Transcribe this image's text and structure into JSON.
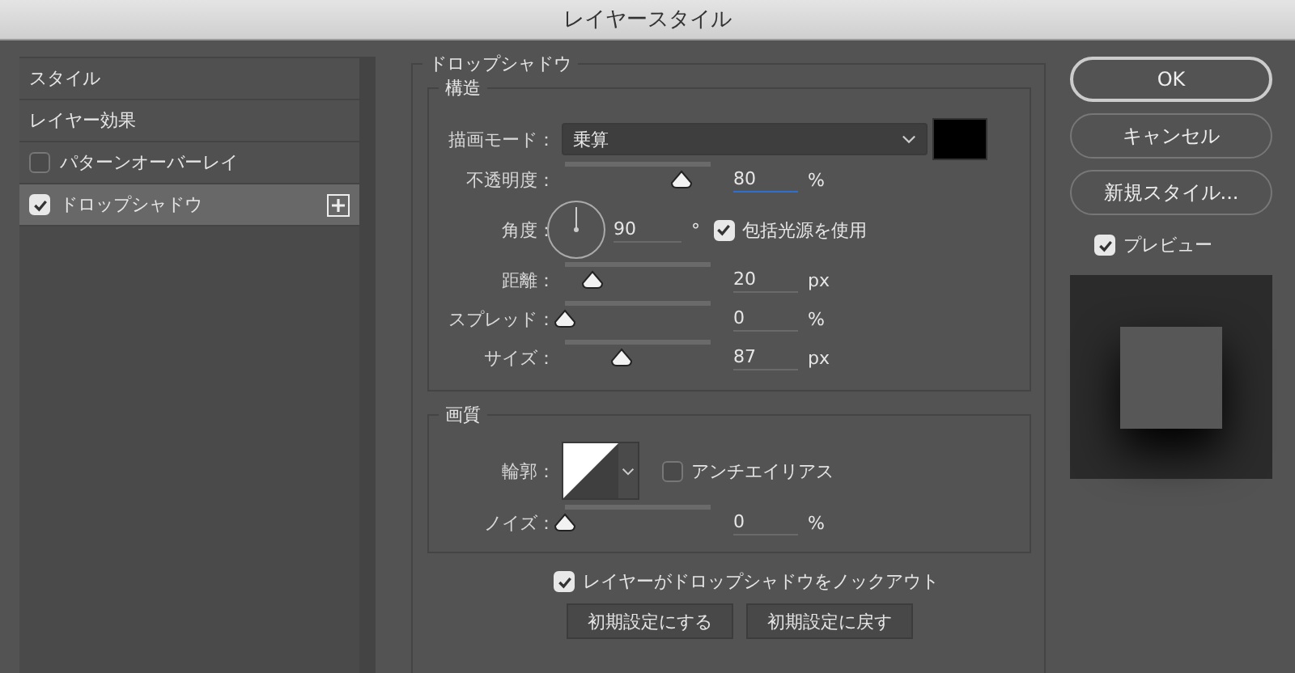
{
  "window": {
    "title": "レイヤースタイル"
  },
  "sidebar": {
    "items": [
      {
        "kind": "heading",
        "label": "スタイル",
        "selected": false
      },
      {
        "kind": "heading",
        "label": "レイヤー効果",
        "selected": false
      },
      {
        "kind": "effect",
        "label": "パターンオーバーレイ",
        "checked": false,
        "selected": false,
        "add_button": false
      },
      {
        "kind": "effect",
        "label": "ドロップシャドウ",
        "checked": true,
        "selected": true,
        "add_button": true
      }
    ]
  },
  "panel": {
    "title": "ドロップシャドウ",
    "structure": {
      "title": "構造",
      "blend_mode": {
        "label": "描画モード：",
        "value": "乗算"
      },
      "rows": [
        {
          "kind": "slider",
          "label": "不透明度：",
          "level": 0.8,
          "value": "80",
          "unit": "%",
          "focused": true
        },
        {
          "kind": "angle",
          "label": "角度：",
          "value": "90",
          "unit": "°",
          "option": {
            "label": "包括光源を使用",
            "checked": true
          }
        },
        {
          "kind": "slider",
          "label": "距離：",
          "level": 0.19,
          "value": "20",
          "unit": "px",
          "focused": false
        },
        {
          "kind": "slider",
          "label": "スプレッド：",
          "level": 0,
          "value": "0",
          "unit": "%",
          "focused": false
        },
        {
          "kind": "slider",
          "label": "サイズ：",
          "level": 0.39,
          "value": "87",
          "unit": "px",
          "focused": false
        }
      ]
    },
    "quality": {
      "title": "画質",
      "contour": {
        "label": "輪郭：",
        "option": {
          "label": "アンチエイリアス",
          "checked": false
        }
      },
      "noise": {
        "label": "ノイズ：",
        "level": 0,
        "value": "0",
        "unit": "%",
        "focused": false
      }
    },
    "knockout": {
      "label": "レイヤーがドロップシャドウをノックアウト",
      "checked": true
    },
    "buttons": [
      "初期設定にする",
      "初期設定に戻す"
    ]
  },
  "actions": {
    "buttons": [
      {
        "label": "OK",
        "kind": "default"
      },
      {
        "label": "キャンセル",
        "kind": "normal"
      },
      {
        "label": "新規スタイル...",
        "kind": "normal"
      }
    ],
    "preview": {
      "label": "プレビュー",
      "checked": true
    }
  }
}
